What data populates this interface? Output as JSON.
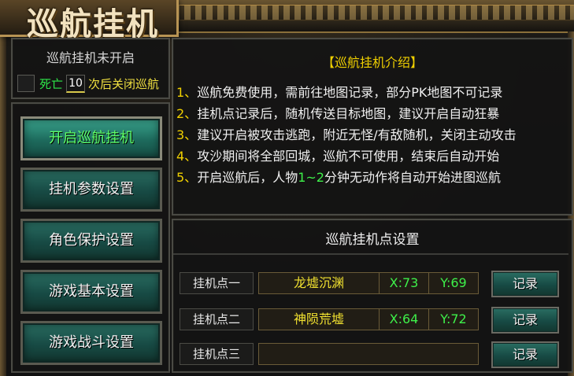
{
  "title": "巡航挂机",
  "status": {
    "text": "巡航挂机未开启",
    "death_label": "死亡",
    "death_count": "10",
    "death_suffix": "次后关闭巡航"
  },
  "buttons": [
    {
      "label": "开启巡航挂机",
      "active": true
    },
    {
      "label": "挂机参数设置",
      "active": false
    },
    {
      "label": "角色保护设置",
      "active": false
    },
    {
      "label": "游戏基本设置",
      "active": false
    },
    {
      "label": "游戏战斗设置",
      "active": false
    }
  ],
  "intro": {
    "title": "【巡航挂机介绍】",
    "lines": [
      {
        "num": "1、",
        "text": "巡航免费使用，需前往地图记录，部分PK地图不可记录"
      },
      {
        "num": "2、",
        "text": "挂机点记录后，随机传送目标地图，建议开启自动狂暴"
      },
      {
        "num": "3、",
        "text": "建议开启被攻击逃跑，附近无怪/有敌随机，关闭主动攻击"
      },
      {
        "num": "4、",
        "text": "攻沙期间将全部回城，巡航不可使用，结束后自动开始"
      },
      {
        "num": "5、",
        "text_a": "开启巡航后，人物",
        "text_green": "1~2",
        "text_b": "分钟无动作将自动开始进图巡航"
      }
    ]
  },
  "points": {
    "title": "巡航挂机点设置",
    "rows": [
      {
        "label": "挂机点一",
        "map": "龙墟沉渊",
        "x": "X:73",
        "y": "Y:69",
        "button": "记录"
      },
      {
        "label": "挂机点二",
        "map": "神陨荒墟",
        "x": "X:64",
        "y": "Y:72",
        "button": "记录"
      },
      {
        "label": "挂机点三",
        "map": "",
        "x": "",
        "y": "",
        "button": "记录"
      }
    ]
  }
}
